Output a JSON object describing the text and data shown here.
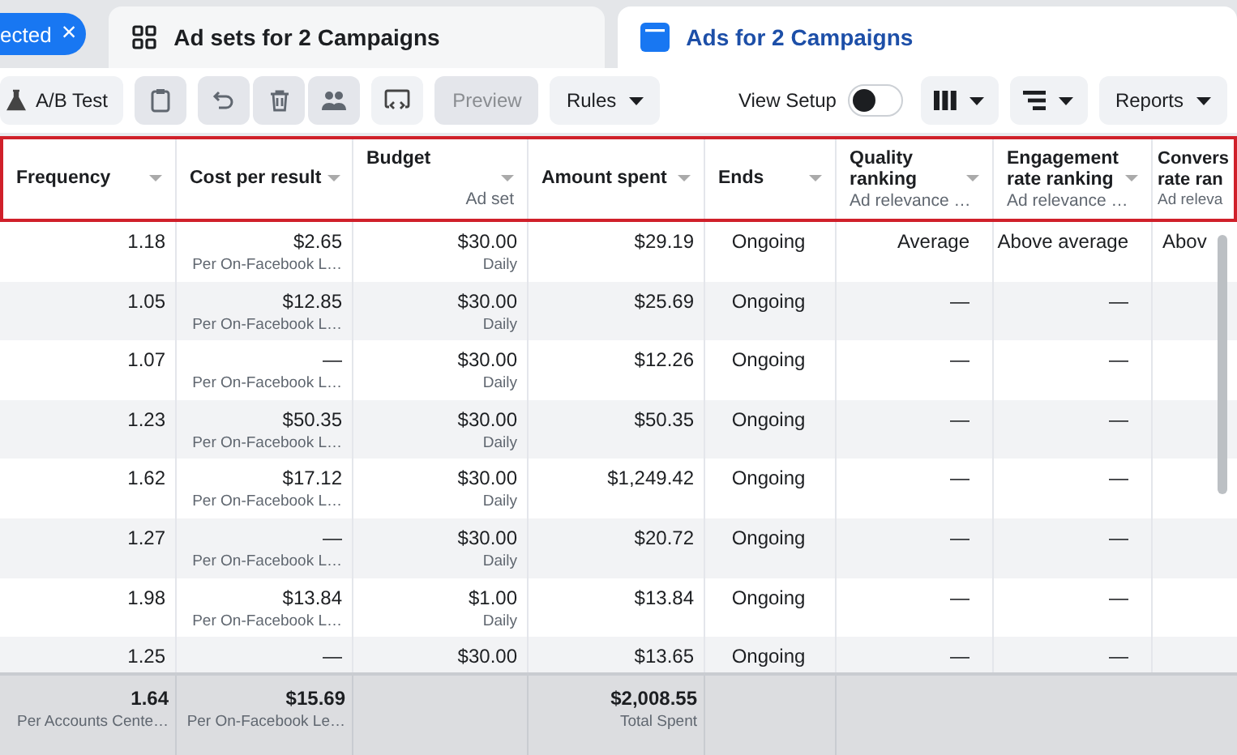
{
  "filter_chip": {
    "label": "ected",
    "close": "×"
  },
  "tabs": [
    {
      "label": "Ad sets for 2 Campaigns",
      "selected": false
    },
    {
      "label": "Ads for 2 Campaigns",
      "selected": true
    }
  ],
  "toolbar": {
    "ab_test": "A/B Test",
    "preview": {
      "label": "Preview",
      "disabled": true
    },
    "rules": "Rules",
    "view_setup": {
      "label": "View Setup",
      "on": false
    },
    "reports": "Reports"
  },
  "table": {
    "header_highlighted": true,
    "columns": [
      {
        "label": "Frequency",
        "total": {
          "value": "1.64",
          "sub": "Per Accounts Cente…"
        }
      },
      {
        "label": "Cost per result",
        "total": {
          "value": "$15.69",
          "sub": "Per On-Facebook Le…"
        }
      },
      {
        "label": "Budget",
        "sub": "Ad set"
      },
      {
        "label": "Amount spent",
        "total": {
          "value": "$2,008.55",
          "sub": "Total Spent"
        }
      },
      {
        "label": "Ends"
      },
      {
        "label": "Quality ranking",
        "sub": "Ad relevance …"
      },
      {
        "label": "Engagement rate ranking",
        "sub": "Ad relevance …"
      },
      {
        "label": "Convers rate ran",
        "sub": "Ad releva"
      }
    ],
    "rows": [
      {
        "cells": [
          {
            "value": "1.18"
          },
          {
            "value": "$2.65",
            "sub": "Per On-Facebook L…"
          },
          {
            "value": "$30.00",
            "sub": "Daily"
          },
          {
            "value": "$29.19"
          },
          {
            "value": "Ongoing"
          },
          {
            "value": "Average"
          },
          {
            "value": "Above average"
          },
          {
            "value": "Abov"
          }
        ]
      },
      {
        "cells": [
          {
            "value": "1.05"
          },
          {
            "value": "$12.85",
            "sub": "Per On-Facebook L…"
          },
          {
            "value": "$30.00",
            "sub": "Daily"
          },
          {
            "value": "$25.69"
          },
          {
            "value": "Ongoing"
          },
          {
            "value": "—"
          },
          {
            "value": "—"
          }
        ]
      },
      {
        "cells": [
          {
            "value": "1.07"
          },
          {
            "value": "—",
            "sub": "Per On-Facebook L…"
          },
          {
            "value": "$30.00",
            "sub": "Daily"
          },
          {
            "value": "$12.26"
          },
          {
            "value": "Ongoing"
          },
          {
            "value": "—"
          },
          {
            "value": "—"
          }
        ]
      },
      {
        "cells": [
          {
            "value": "1.23"
          },
          {
            "value": "$50.35",
            "sub": "Per On-Facebook L…"
          },
          {
            "value": "$30.00",
            "sub": "Daily"
          },
          {
            "value": "$50.35"
          },
          {
            "value": "Ongoing"
          },
          {
            "value": "—"
          },
          {
            "value": "—"
          }
        ]
      },
      {
        "cells": [
          {
            "value": "1.62"
          },
          {
            "value": "$17.12",
            "sub": "Per On-Facebook L…"
          },
          {
            "value": "$30.00",
            "sub": "Daily"
          },
          {
            "value": "$1,249.42"
          },
          {
            "value": "Ongoing"
          },
          {
            "value": "—"
          },
          {
            "value": "—"
          }
        ]
      },
      {
        "cells": [
          {
            "value": "1.27"
          },
          {
            "value": "—",
            "sub": "Per On-Facebook L…"
          },
          {
            "value": "$30.00",
            "sub": "Daily"
          },
          {
            "value": "$20.72"
          },
          {
            "value": "Ongoing"
          },
          {
            "value": "—"
          },
          {
            "value": "—"
          }
        ]
      },
      {
        "cells": [
          {
            "value": "1.98"
          },
          {
            "value": "$13.84",
            "sub": "Per On-Facebook L…"
          },
          {
            "value": "$1.00",
            "sub": "Daily"
          },
          {
            "value": "$13.84"
          },
          {
            "value": "Ongoing"
          },
          {
            "value": "—"
          },
          {
            "value": "—"
          }
        ]
      },
      {
        "cells": [
          {
            "value": "1.25"
          },
          {
            "value": "—"
          },
          {
            "value": "$30.00"
          },
          {
            "value": "$13.65"
          },
          {
            "value": "Ongoing"
          },
          {
            "value": "—"
          },
          {
            "value": "—"
          }
        ]
      }
    ]
  }
}
